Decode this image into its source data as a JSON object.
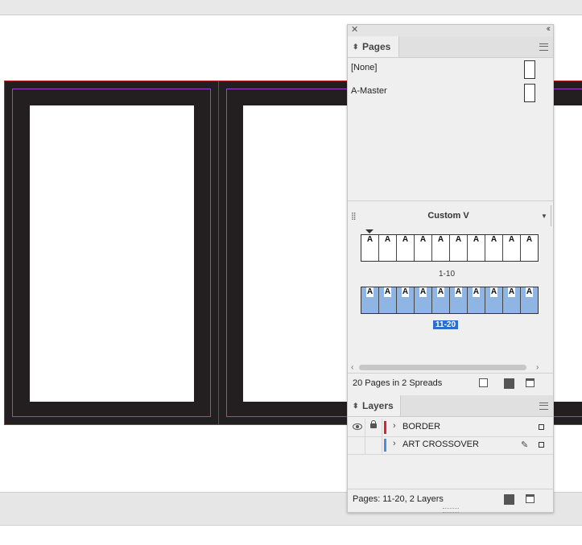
{
  "pages_panel": {
    "tab_label": "Pages",
    "masters": [
      "[None]",
      "A-Master"
    ],
    "view_label": "Custom V",
    "spreads": [
      {
        "label": "1-10",
        "prefixes": [
          "A",
          "A",
          "A",
          "A",
          "A",
          "A",
          "A",
          "A",
          "A",
          "A"
        ],
        "selected": false
      },
      {
        "label": "11-20",
        "prefixes": [
          "A",
          "A",
          "A",
          "A",
          "A",
          "A",
          "A",
          "A",
          "A",
          "A"
        ],
        "selected": true
      }
    ],
    "footer_text": "20 Pages in 2 Spreads"
  },
  "layers_panel": {
    "tab_label": "Layers",
    "layers": [
      {
        "name": "BORDER",
        "color": "#e0202a"
      },
      {
        "name": "ART CROSSOVER",
        "color": "#4a8fe0"
      }
    ],
    "footer_text": "Pages: 11-20, 2 Layers"
  },
  "colors": {
    "page_fill": "#231f20",
    "bleed_guide": "#c8202a",
    "margin_guide": "#a040d8",
    "selection": "#2d6fcf",
    "selected_pages": "#8fb5e5"
  }
}
